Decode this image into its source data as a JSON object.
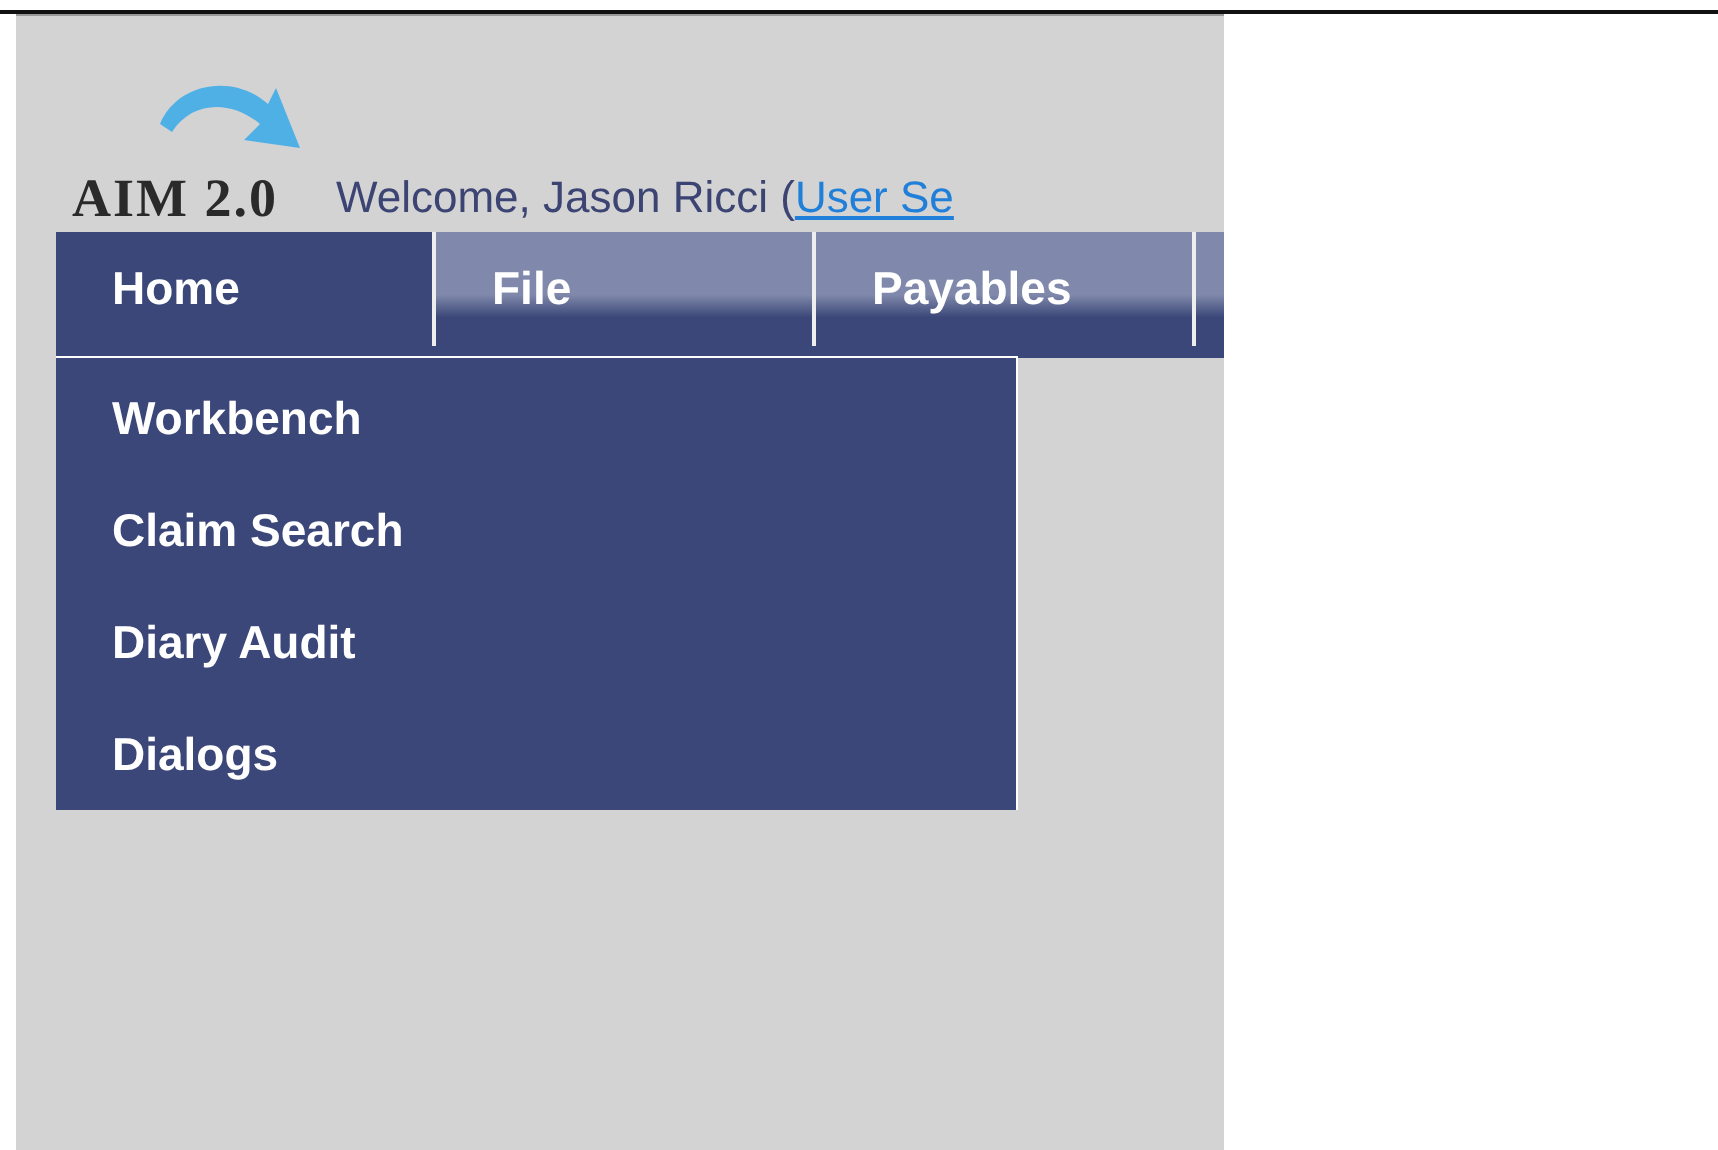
{
  "logo": {
    "text": "AIM 2.0"
  },
  "welcome": {
    "text": "Welcome, Jason Ricci (",
    "link": "User Se"
  },
  "tabs": [
    {
      "label": "Home",
      "selected": true
    },
    {
      "label": "File",
      "selected": false
    },
    {
      "label": "Payables",
      "selected": false
    }
  ],
  "dropdown": {
    "items": [
      "Workbench",
      "Claim Search",
      "Diary Audit",
      "Dialogs"
    ]
  }
}
